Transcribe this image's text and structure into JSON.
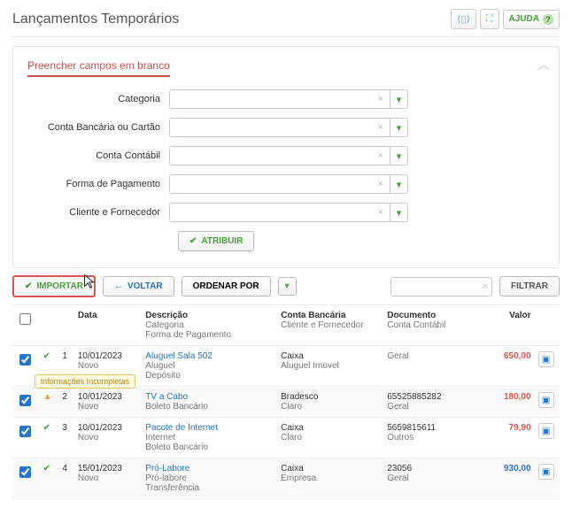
{
  "header": {
    "title": "Lançamentos Temporários",
    "help_label": "AJUDA"
  },
  "fill_section": {
    "title": "Preencher campos em branco",
    "fields": {
      "categoria": "Categoria",
      "conta_bancaria": "Conta Bancária ou Cartão",
      "conta_contabil": "Conta Contábil",
      "forma_pagamento": "Forma de Pagamento",
      "cliente_fornecedor": "Cliente e Fornecedor"
    },
    "atribuir_label": "ATRIBUIR"
  },
  "actions": {
    "importar": "IMPORTAR",
    "voltar": "VOLTAR",
    "ordenar": "ORDENAR POR",
    "filtrar": "FILTRAR"
  },
  "columns": {
    "data": "Data",
    "descricao": "Descrição",
    "categoria_sub": "Categoria",
    "forma_sub": "Forma de Pagamento",
    "conta_bancaria": "Conta Bancária",
    "cliente_sub": "Cliente e Fornecedor",
    "documento": "Documento",
    "conta_contabil_sub": "Conta Contábil",
    "valor": "Valor"
  },
  "tooltip_incomplete": "Informações Incompletas",
  "rows": [
    {
      "idx": "1",
      "status": "ok",
      "date": "10/01/2023",
      "date_sub": "Novo",
      "desc": "Aluguel Sala 502",
      "categoria": "Aluguel",
      "forma": "Depósito",
      "conta": "Caixa",
      "cliente": "Aluguel Imovel",
      "doc": "",
      "contabil": "Geral",
      "valor": "650,00",
      "valor_class": "red"
    },
    {
      "idx": "2",
      "status": "warn",
      "date": "10/01/2023",
      "date_sub": "Novo",
      "desc": "TV a Cabo",
      "categoria": "",
      "forma": "Boleto Bancário",
      "conta": "Bradesco",
      "cliente": "Claro",
      "doc": "65525885282",
      "contabil": "Geral",
      "valor": "180,00",
      "valor_class": "red"
    },
    {
      "idx": "3",
      "status": "ok",
      "date": "10/01/2023",
      "date_sub": "Novo",
      "desc": "Pacote de Internet",
      "categoria": "Internet",
      "forma": "Boleto Bancário",
      "conta": "Caixa",
      "cliente": "Claro",
      "doc": "5659815611",
      "contabil": "Outros",
      "valor": "79,90",
      "valor_class": "red"
    },
    {
      "idx": "4",
      "status": "ok",
      "date": "15/01/2023",
      "date_sub": "Novo",
      "desc": "Pró-Labore",
      "categoria": "Pró-labore",
      "forma": "Transferência",
      "conta": "Caixa",
      "cliente": "Empresa",
      "doc": "23056",
      "contabil": "Geral",
      "valor": "930,00",
      "valor_class": "blue"
    }
  ]
}
